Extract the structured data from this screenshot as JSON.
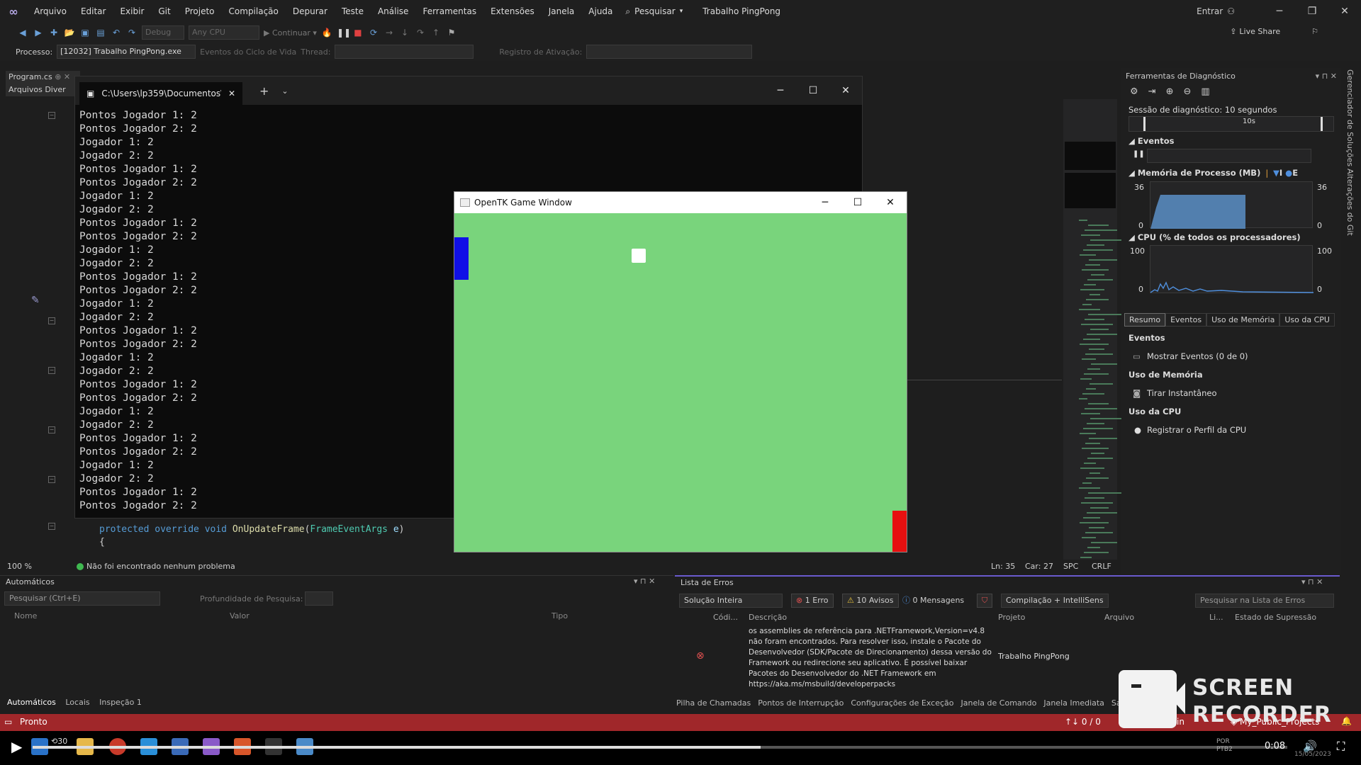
{
  "menubar": {
    "items": [
      "Arquivo",
      "Editar",
      "Exibir",
      "Git",
      "Projeto",
      "Compilação",
      "Depurar",
      "Teste",
      "Análise",
      "Ferramentas",
      "Extensões",
      "Janela",
      "Ajuda"
    ],
    "search_label": "Pesquisar",
    "solution_title": "Trabalho PingPong",
    "signin_label": "Entrar"
  },
  "toolbar": {
    "config": "Debug",
    "platform": "Any CPU",
    "continue_label": "Continuar",
    "live_share": "Live Share"
  },
  "toolbar2": {
    "process_label": "Processo:",
    "process_value": "[12032] Trabalho PingPong.exe",
    "lifecycle_label": "Eventos do Ciclo de Vida",
    "thread_label": "Thread:",
    "stack_label": "Registro de Ativação:"
  },
  "editor": {
    "file_tab": "Program.cs",
    "nav_label": "Arquivos Diver",
    "code_line_kw": "protected override void ",
    "code_line_fn": "OnUpdateFrame",
    "code_line_ty": "FrameEventArgs",
    "code_line_pn": " e",
    "code_brace": "{"
  },
  "console": {
    "tab_title": "C:\\Users\\lp359\\Documentos\\",
    "lines": [
      "Pontos Jogador 1: 2",
      "Pontos Jogador 2: 2",
      "Jogador 1: 2",
      "Jogador 2: 2",
      "Pontos Jogador 1: 2",
      "Pontos Jogador 2: 2",
      "Jogador 1: 2",
      "Jogador 2: 2",
      "Pontos Jogador 1: 2",
      "Pontos Jogador 2: 2",
      "Jogador 1: 2",
      "Jogador 2: 2",
      "Pontos Jogador 1: 2",
      "Pontos Jogador 2: 2",
      "Jogador 1: 2",
      "Jogador 2: 2",
      "Pontos Jogador 1: 2",
      "Pontos Jogador 2: 2",
      "Jogador 1: 2",
      "Jogador 2: 2",
      "Pontos Jogador 1: 2",
      "Pontos Jogador 2: 2",
      "Jogador 1: 2",
      "Jogador 2: 2",
      "Pontos Jogador 1: 2",
      "Pontos Jogador 2: 2",
      "Jogador 1: 2",
      "Jogador 2: 2",
      "Pontos Jogador 1: 2",
      "Pontos Jogador 2: 2"
    ]
  },
  "game": {
    "title": "OpenTK Game Window",
    "background": "#79d47c",
    "left_paddle_color": "#1010e6",
    "right_paddle_color": "#e61010",
    "ball_color": "#ffffff"
  },
  "diagnostics": {
    "title": "Ferramentas de Diagnóstico",
    "session": "Sessão de diagnóstico: 10 segundos",
    "timeline_mark": "10s",
    "events_title": "Eventos",
    "memory_title": "Memória de Processo (MB)",
    "memory_legend_e": "E",
    "memory_legend_i": "I",
    "memory_max": "36",
    "memory_min": "0",
    "cpu_title": "CPU (% de todos os processadores)",
    "cpu_max": "100",
    "cpu_min": "0",
    "tabs": [
      "Resumo",
      "Eventos",
      "Uso de Memória",
      "Uso da CPU"
    ],
    "summary_events": "Eventos",
    "show_events": "Mostrar Eventos (0 de 0)",
    "mem_usage": "Uso de Memória",
    "snapshot": "Tirar Instantâneo",
    "cpu_usage": "Uso da CPU",
    "record_cpu": "Registrar o Perfil da CPU"
  },
  "side_tabs": [
    "Gerenciador de Soluções",
    "Alterações do Git"
  ],
  "status_strip": {
    "zoom": "100 %",
    "no_problems": "Não foi encontrado nenhum problema",
    "line": "Ln: 35",
    "col": "Car: 27",
    "spc": "SPC",
    "eol": "CRLF"
  },
  "autos": {
    "title": "Automáticos",
    "search_placeholder": "Pesquisar (Ctrl+E)",
    "depth_label": "Profundidade de Pesquisa:",
    "columns": [
      "Nome",
      "Valor",
      "Tipo"
    ],
    "bottom_tabs": [
      "Automáticos",
      "Locais",
      "Inspeção 1"
    ]
  },
  "errors": {
    "title": "Lista de Erros",
    "scope": "Solução Inteira",
    "errors_count": "1 Erro",
    "warnings_count": "10 Avisos",
    "messages_count": "0 Mensagens",
    "build_filter": "Compilação + IntelliSens",
    "search_placeholder": "Pesquisar na Lista de Erros",
    "columns": [
      "Códi...",
      "Descrição",
      "Projeto",
      "Arquivo",
      "Li...",
      "Estado de Supressão"
    ],
    "row_description": "os assemblies de referência para .NETFramework,Version=v4.8 não foram encontrados. Para resolver isso, instale o Pacote do Desenvolvedor (SDK/Pacote de Direcionamento) dessa versão do Framework ou redirecione seu aplicativo. É possível baixar Pacotes do Desenvolvedor do .NET Framework em https://aka.ms/msbuild/developerpacks",
    "row_project": "Trabalho PingPong",
    "bottom_tabs": [
      "Pilha de Chamadas",
      "Pontos de Interrupção",
      "Configurações de Exceção",
      "Janela de Comando",
      "Janela Imediata",
      "Saída"
    ]
  },
  "statusbar": {
    "ready": "Pronto",
    "git_counts": "↑↓ 0 / 0",
    "branch": "main",
    "repo": "My_Public_Projects"
  },
  "player": {
    "time": "0:08",
    "progress": 0.58,
    "sys_lang": "POR",
    "sys_kb": "PTB2",
    "date": "15/05/2023",
    "skip_label": "30"
  },
  "recorder": {
    "line1": "SCREEN",
    "line2": "RECORDER"
  }
}
